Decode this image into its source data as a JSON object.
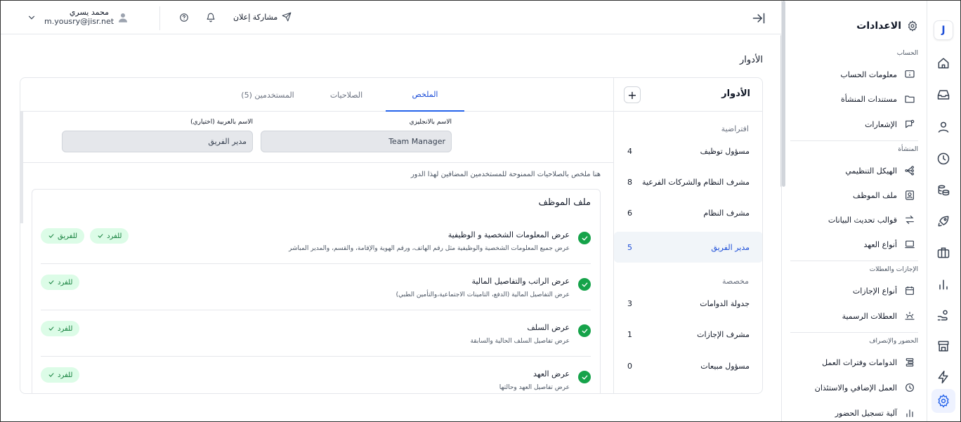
{
  "app": {
    "logo": "J"
  },
  "topbar": {
    "share_label": "مشاركة إعلان",
    "user_name": "محمد يسري",
    "user_email": "m.yousry@jisr.net"
  },
  "settings": {
    "title": "الاعدادات",
    "sections": [
      {
        "label": "الحساب",
        "items": [
          "معلومات الحساب",
          "مستندات المنشأة",
          "الإشعارات"
        ]
      },
      {
        "label": "المنشأة",
        "items": [
          "الهيكل التنظيمي",
          "ملف الموظف",
          "قوالب تحديث البيانات",
          "أنواع العهد"
        ]
      },
      {
        "label": "الإجازات والعطلات",
        "items": [
          "أنواع الإجازات",
          "العطلات الرسمية"
        ]
      },
      {
        "label": "الحضور والإنصراف",
        "items": [
          "الدوامات وفترات العمل",
          "العمل الإضافي والاستئذان",
          "آلية تسجيل الحضور"
        ]
      }
    ]
  },
  "page": {
    "title": "الأدوار"
  },
  "roles": {
    "header": "الأدوار",
    "add_label": "+",
    "groups": [
      {
        "label": "افتراضية",
        "items": [
          {
            "name": "مسؤول توظيف",
            "count": "4"
          },
          {
            "name": "مشرف النظام والشركات الفرعية",
            "count": "8"
          },
          {
            "name": "مشرف النظام",
            "count": "6"
          },
          {
            "name": "مدير الفريق",
            "count": "5"
          }
        ]
      },
      {
        "label": "مخصصة",
        "items": [
          {
            "name": "جدولة الدوامات",
            "count": "3"
          },
          {
            "name": "مشرف الإجازات",
            "count": "1"
          },
          {
            "name": "مسؤول مبيعات",
            "count": "0"
          }
        ]
      }
    ]
  },
  "tabs": [
    "الملخص",
    "الصلاحيات",
    "المستخدمين (5)"
  ],
  "form": {
    "en_label": "الاسم بالانجليزي",
    "en_value": "Team Manager",
    "ar_label": "الاسم بالعربية (اختياري)",
    "ar_value": "مدير الفريق"
  },
  "summary": {
    "note": "هنا ملخص بالصلاحيات الممنوحة للمستخدمين المضافين لهذا الدور",
    "section_title": "ملف الموظف",
    "permissions": [
      {
        "title": "عرض المعلومات الشخصية و الوظيفية",
        "desc": "عرض جميع المعلومات الشخصية والوظيفية مثل رقم الهاتف، ورقم الهوية والإقامة، والقسم، والمدير المباشر",
        "badges": [
          "للفرد",
          "للفريق"
        ]
      },
      {
        "title": "عرض الراتب والتفاصيل المالية",
        "desc": "عرض التفاصيل المالية (الدفع، التامينات الاجتماعية،والتأمين الطبي)",
        "badges": [
          "للفرد"
        ]
      },
      {
        "title": "عرض السلف",
        "desc": "عرض تفاصيل السلف الحالية والسابقة",
        "badges": [
          "للفرد"
        ]
      },
      {
        "title": "عرض العهد",
        "desc": "عرض تفاصيل العهد وحالتها",
        "badges": [
          "للفرد"
        ]
      }
    ]
  },
  "colors": {
    "accent": "#2563eb",
    "success": "#16a34a",
    "badge_bg": "#dcfce7"
  }
}
